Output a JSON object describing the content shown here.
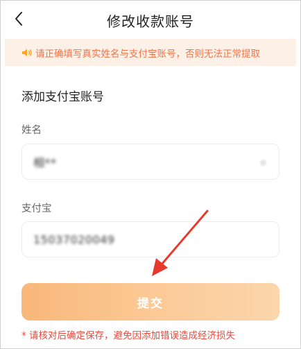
{
  "header": {
    "back_icon": "chevron-left-icon",
    "title": "修改收款账号"
  },
  "notice": {
    "icon": "speaker-icon",
    "text": "请正确填写真实姓名与支付宝账号，否则无法正常提取",
    "color": "#f0754a",
    "background": "#fdf0e6"
  },
  "form": {
    "section_title": "添加支付宝账号",
    "name": {
      "label": "姓名",
      "value": "相**"
    },
    "alipay": {
      "label": "支付宝",
      "value": "15037020049"
    }
  },
  "submit": {
    "label": "提交",
    "gradient_start": "#f9b77a",
    "gradient_end": "#fbd6ac"
  },
  "footer_warning": "* 请核对后确定保存，避免因添加错误造成经济损失",
  "annotation": {
    "arrow_color": "#e8392d",
    "arrow_target": "submit-button"
  }
}
